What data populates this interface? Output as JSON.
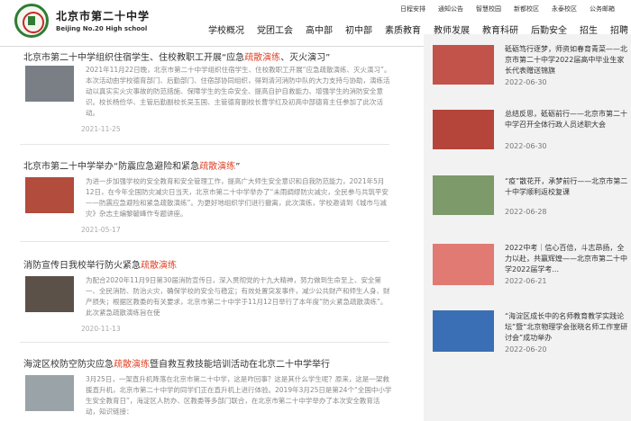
{
  "header": {
    "school_name_cn": "北京市第二十中学",
    "school_name_en": "Beijing No.20 High school",
    "top_links": [
      "日程安排",
      "通知公告",
      "智慧校园",
      "新都校区",
      "永泰校区",
      "公务邮箱"
    ],
    "nav": [
      "学校概况",
      "党团工会",
      "高中部",
      "初中部",
      "素质教育",
      "教师发展",
      "教育科研",
      "后勤安全",
      "招生",
      "招聘"
    ]
  },
  "articles": [
    {
      "title_pre": "北京市第二十中学组织住宿学生、住校教职工开展“应急",
      "title_hl": "疏散演练",
      "title_post": "、灭火演习”",
      "summary": "2021年11月22日晚，北京市第二十中学组织住宿学生、住校教职工开展“应急疏散演练、灭火演习”。本次活动由学校德育部门、后勤部门、住宿部协同组织，得到清河消防中队的大力支持与协助，演练活动以真实实火灾事故的防范措施、保障学生的生命安全、提高自护自救能力、增强学生的消防安全意识。校长杨俭华、主管后勤副校长吴玉国、主管德育副校长曹学红及初高中部德育主任参加了此次活动。",
      "date": "2021-11-25"
    },
    {
      "title_pre": "北京市第二十中学举办“防震应急避险和紧急",
      "title_hl": "疏散演练",
      "title_post": "”",
      "summary": "为进一步加强学校的安全教育和安全管理工作，提高广大师生安全意识和自我防范能力，2021年5月12日，在今年全国防灾减灾日当天，北京市第二十中学举办了“未雨绸缪防灾减灾，全民参与共筑平安——防震应急避险和紧急疏散演练”。为更好地组织学们进行撤离，此次演练，学校邀请到《城市与减灾》杂志主编黎毓峰作专题讲座。",
      "date": "2021-05-17"
    },
    {
      "title_pre": "消防宣传日我校举行防火紧急",
      "title_hl": "疏散演练",
      "title_post": "",
      "summary": "为配合2020年11月9日第30届消防宣传日，深入贯彻党的十九大精神，努力做到生命至上、安全第一、全民消防、防治火灾，确保学校的安全与稳定；有效处置突发事件，减少公共财产和师生人身、财产损失；根据区教委的有关要求，北京市第二十中学于11月12日举行了本年度“防火紧急疏散演练”。此次紧急疏散演练旨在使",
      "date": "2020-11-13"
    },
    {
      "title_pre": "海淀区校防空防灾应急",
      "title_hl": "疏散演练",
      "title_post": "暨自救互救技能培训活动在北京二十中学举行",
      "summary": "3月25日，一架直升机降落在北京市第二十中学，这是咋回事？这是其什么学生呢？原来，这是一架救援直升机，北京市第二十中学的同学们正在直升机上进行体验。2019年3月25日是第24个“全国中小学生安全教育日”，海淀区人防办、区教委等多部门联合，在北京市第二十中学举办了本次安全教育活动，知识链接：",
      "date": ""
    }
  ],
  "sidebar": [
    {
      "title": "砥砺笃行逐梦，师资如春育青菜——北京市第二十中学2022届高中毕业生家长代表赠送锦旗",
      "date": "2022-06-30"
    },
    {
      "title": "总结反思，砥砺前行——北京市第二十中学召开全体行政人员述职大会",
      "date": "2022-06-30"
    },
    {
      "title": "“疫”散花开，承梦前行——北京市第二十中学顺利返校复课",
      "date": "2022-06-28"
    },
    {
      "title": "2022中考｜信心百倍，斗志昂扬，全力以赴，共赢辉煌——北京市第二十中学2022届学考...",
      "date": "2022-06-21"
    },
    {
      "title": "“海淀区成长中的名师教育教学实践论坛”暨“北京物理学会张晓名师工作室研讨会”成功举办",
      "date": "2022-06-20"
    }
  ]
}
